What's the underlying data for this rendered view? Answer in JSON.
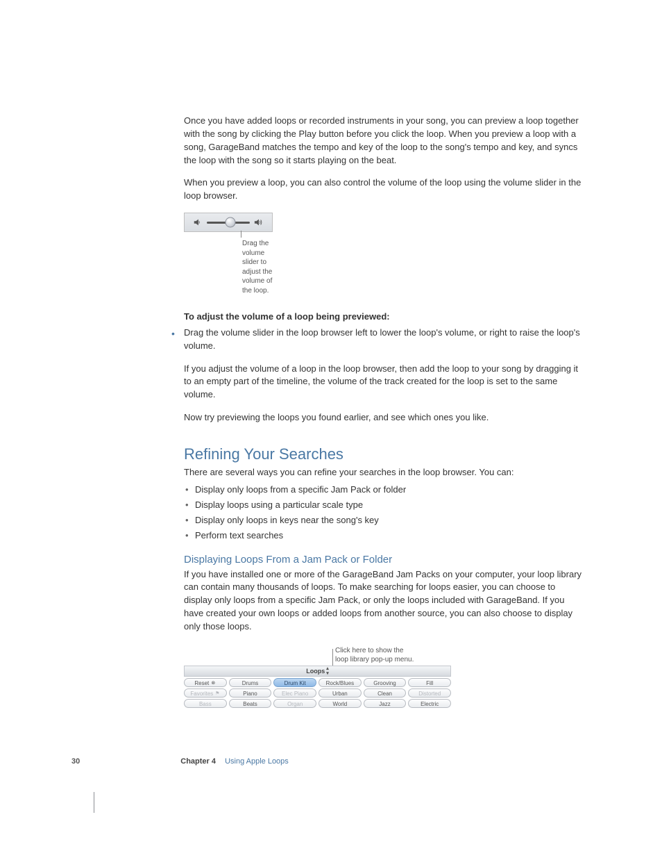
{
  "para1": "Once you have added loops or recorded instruments in your song, you can preview a loop together with the song by clicking the Play button before you click the loop. When you preview a loop with a song, GarageBand matches the tempo and key of the loop to the song's tempo and key, and syncs the loop with the song so it starts playing on the beat.",
  "para2": "When you preview a loop, you can also control the volume of the loop using the volume slider in the loop browser.",
  "vol_caption_l1": "Drag the volume slider to",
  "vol_caption_l2": "adjust the volume of the loop.",
  "adjust_heading": "To adjust the volume of a loop being previewed:",
  "adjust_bullet": "Drag the volume slider in the loop browser left to lower the loop's volume, or right to raise the loop's volume.",
  "adjust_para": "If you adjust the volume of a loop in the loop browser, then add the loop to your song by dragging it to an empty part of the timeline, the volume of the track created for the loop is set to the same volume.",
  "try_para": "Now try previewing the loops you found earlier, and see which ones you like.",
  "h2": "Refining Your Searches",
  "refine_intro": "There are several ways you can refine your searches in the loop browser. You can:",
  "refine_items": {
    "0": "Display only loops from a specific Jam Pack or folder",
    "1": "Display loops using a particular scale type",
    "2": "Display only loops in keys near the song's key",
    "3": "Perform text searches"
  },
  "h3": "Displaying Loops From a Jam Pack or Folder",
  "jam_para": "If you have installed one or more of the GarageBand Jam Packs on your computer, your loop library can contain many thousands of loops. To make searching for loops easier, you can choose to display only loops from a specific Jam Pack, or only the loops included with GarageBand. If you have created your own loops or added loops from another source, you can also choose to display only those loops.",
  "loop_anno_l1": "Click here to show the",
  "loop_anno_l2": "loop library pop-up menu.",
  "loops_label": "Loops",
  "btns": {
    "r0": {
      "0": "Reset",
      "1": "Drums",
      "2": "Drum Kit",
      "3": "Rock/Blues",
      "4": "Grooving",
      "5": "Fill"
    },
    "r1": {
      "0": "Favorites",
      "1": "Piano",
      "2": "Elec Piano",
      "3": "Urban",
      "4": "Clean",
      "5": "Distorted"
    },
    "r2": {
      "0": "Bass",
      "1": "Beats",
      "2": "Organ",
      "3": "World",
      "4": "Jazz",
      "5": "Electric"
    }
  },
  "footer": {
    "page": "30",
    "chapter_label": "Chapter 4",
    "chapter_title": "Using Apple Loops"
  }
}
